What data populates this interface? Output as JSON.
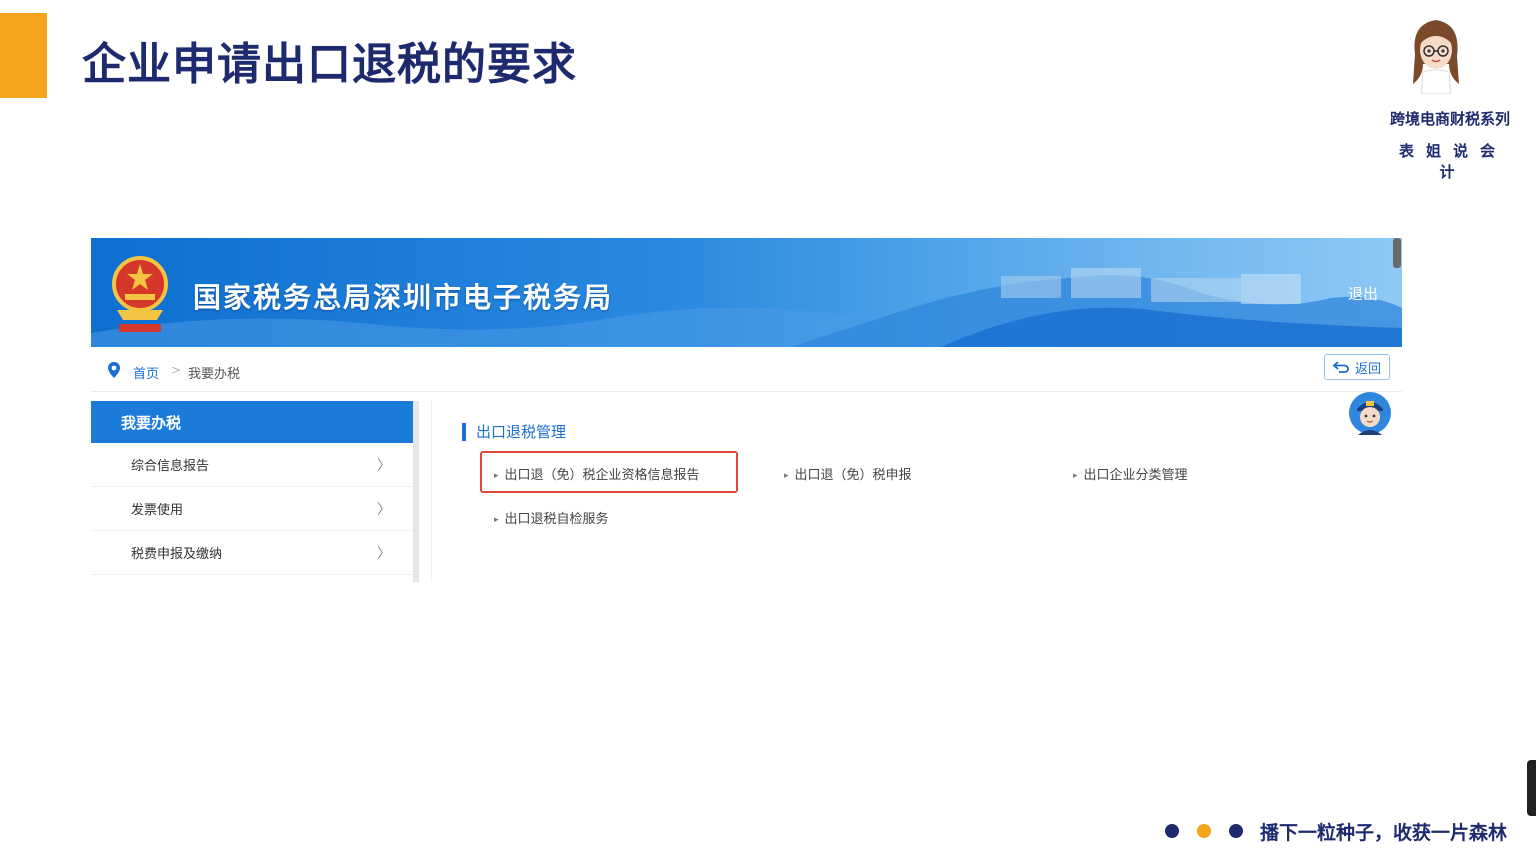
{
  "slide": {
    "title": "企业申请出口退税的要求",
    "brand_series": "跨境电商财税系列",
    "brand_name": "表姐说会计",
    "slogan": "播下一粒种子，收获一片森林"
  },
  "portal": {
    "title": "国家税务总局深圳市电子税务局",
    "logout": "退出",
    "breadcrumb": {
      "home": "首页",
      "separator": ">",
      "current": "我要办税"
    },
    "back_button": "返回",
    "sidebar": {
      "header": "我要办税",
      "items": [
        {
          "label": "综合信息报告",
          "chevron": "〉"
        },
        {
          "label": "发票使用",
          "chevron": "〉"
        },
        {
          "label": "税费申报及缴纳",
          "chevron": "〉"
        }
      ]
    },
    "content": {
      "section_title": "出口退税管理",
      "links": [
        "出口退（免）税企业资格信息报告",
        "出口退（免）税申报",
        "出口企业分类管理",
        "出口退税自检服务"
      ]
    }
  },
  "colors": {
    "accent": "#f5a51b",
    "title_navy": "#1e2a6e",
    "portal_blue": "#1a7bd8",
    "highlight_red": "#e0483b"
  },
  "icons": {
    "brand_avatar": "cartoon-girl-avatar",
    "portal_logo": "national-emblem-icon",
    "location": "location-pin-icon",
    "back": "back-arrow-icon",
    "assistant": "robot-assistant-icon"
  }
}
